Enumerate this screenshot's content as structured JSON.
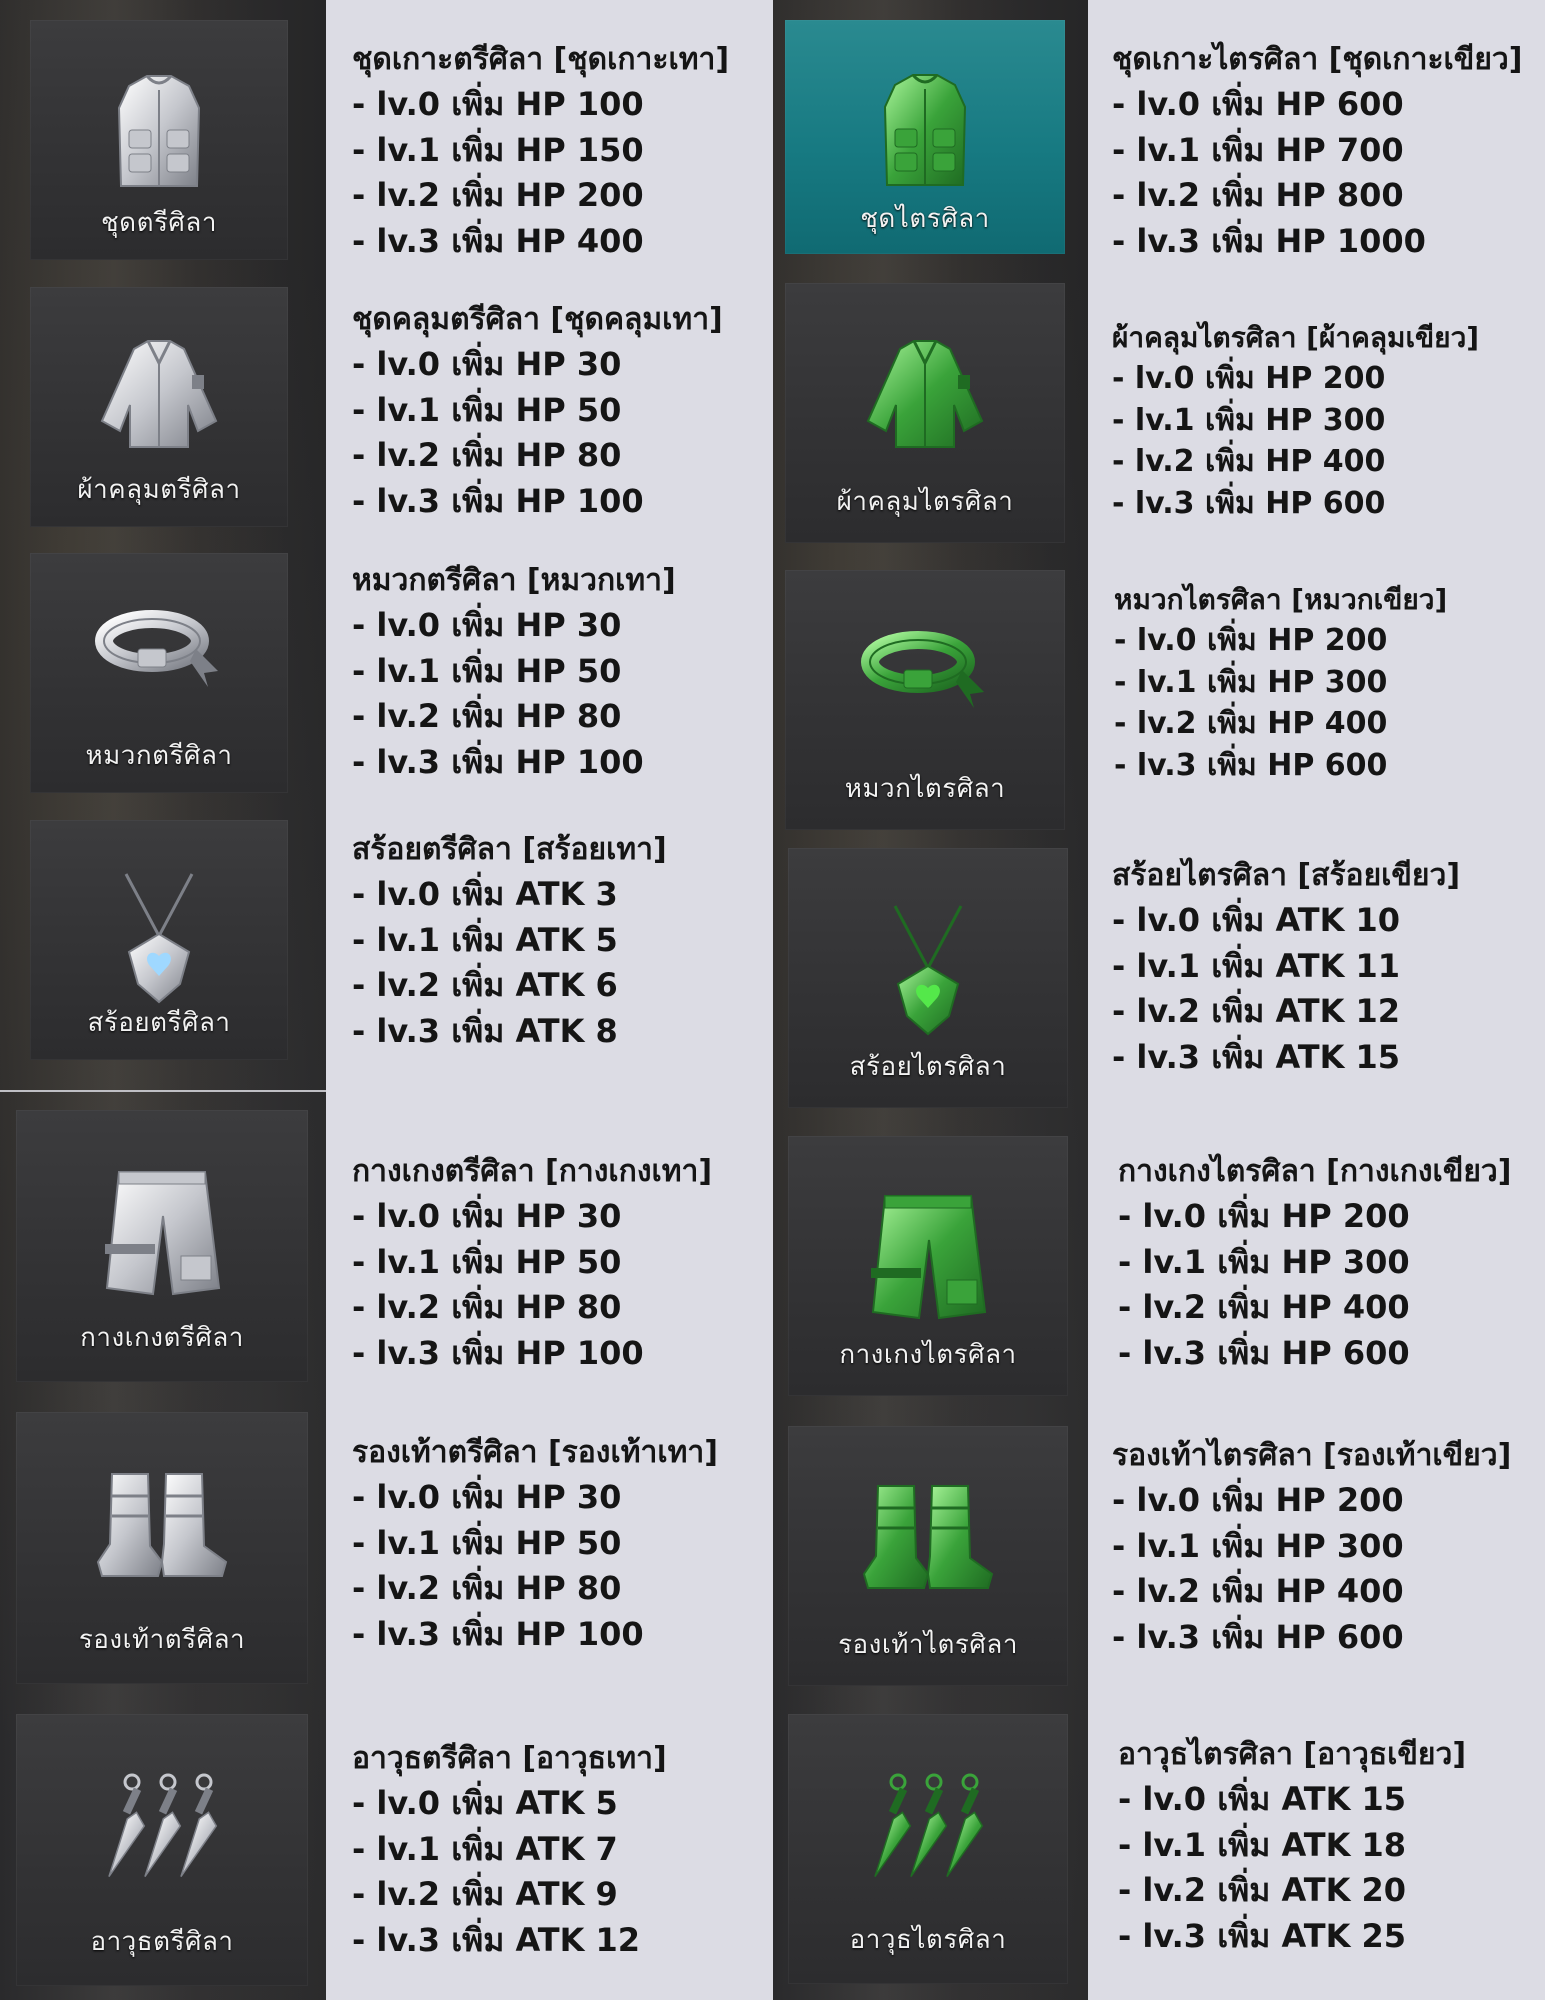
{
  "colors": {
    "page_bg": "#dcdce4",
    "tile_bg": "#333335",
    "tile_selected": "#177a82",
    "silver": "#c8c9ce",
    "green": "#3fa640",
    "text": "#151515"
  },
  "left_column": [
    {
      "icon": "vest-icon",
      "tile_label": "ชุดตรีศิลา",
      "title": "ชุดเกาะตรีศิลา [ชุดเกาะเทา]",
      "lines": [
        "- lv.0 เพิ่ม HP 100",
        "- lv.1 เพิ่ม HP 150",
        "- lv.2 เพิ่ม HP 200",
        "- lv.3 เพิ่ม HP 400"
      ]
    },
    {
      "icon": "jacket-icon",
      "tile_label": "ผ้าคลุมตรีศิลา",
      "title": "ชุดคลุมตรีศิลา [ชุดคลุมเทา]",
      "lines": [
        "- lv.0 เพิ่ม HP 30",
        "- lv.1 เพิ่ม HP 50",
        "- lv.2 เพิ่ม HP 80",
        "- lv.3 เพิ่ม HP 100"
      ]
    },
    {
      "icon": "headband-icon",
      "tile_label": "หมวกตรีศิลา",
      "title": "หมวกตรีศิลา [หมวกเทา]",
      "lines": [
        "- lv.0 เพิ่ม HP 30",
        "- lv.1 เพิ่ม HP 50",
        "- lv.2 เพิ่ม HP 80",
        "- lv.3 เพิ่ม HP 100"
      ]
    },
    {
      "icon": "necklace-icon",
      "tile_label": "สร้อยตรีศิลา",
      "title": "สร้อยตรีศิลา [สร้อยเทา]",
      "lines": [
        "- lv.0 เพิ่ม ATK 3",
        "- lv.1 เพิ่ม ATK 5",
        "- lv.2 เพิ่ม ATK 6",
        "- lv.3 เพิ่ม ATK 8"
      ]
    },
    {
      "icon": "pants-icon",
      "tile_label": "กางเกงตรีศิลา",
      "title": "กางเกงตรีศิลา [กางเกงเทา]",
      "lines": [
        "- lv.0 เพิ่ม HP 30",
        "- lv.1 เพิ่ม HP 50",
        "- lv.2 เพิ่ม HP 80",
        "- lv.3 เพิ่ม HP 100"
      ]
    },
    {
      "icon": "boots-icon",
      "tile_label": "รองเท้าตรีศิลา",
      "title": "รองเท้าตรีศิลา [รองเท้าเทา]",
      "lines": [
        "- lv.0 เพิ่ม HP 30",
        "- lv.1 เพิ่ม HP 50",
        "- lv.2 เพิ่ม HP 80",
        "- lv.3 เพิ่ม HP 100"
      ]
    },
    {
      "icon": "kunai-icon",
      "tile_label": "อาวุธตรีศิลา",
      "title": "อาวุธตรีศิลา [อาวุธเทา]",
      "lines": [
        "- lv.0 เพิ่ม ATK 5",
        "- lv.1 เพิ่ม ATK 7",
        "- lv.2 เพิ่ม ATK 9",
        "- lv.3 เพิ่ม ATK 12"
      ]
    }
  ],
  "right_column": [
    {
      "icon": "vest-icon",
      "tile_label": "ชุดไตรศิลา",
      "title": "ชุดเกาะไตรศิลา [ชุดเกาะเขียว]",
      "lines": [
        "- lv.0 เพิ่ม HP 600",
        "- lv.1 เพิ่ม HP 700",
        "- lv.2 เพิ่ม HP 800",
        "- lv.3 เพิ่ม HP 1000"
      ]
    },
    {
      "icon": "jacket-icon",
      "tile_label": "ผ้าคลุมไตรศิลา",
      "title": "ผ้าคลุมไตรศิลา [ผ้าคลุมเขียว]",
      "lines": [
        "- lv.0 เพิ่ม HP 200",
        "- lv.1 เพิ่ม HP 300",
        "- lv.2 เพิ่ม HP 400",
        "- lv.3 เพิ่ม HP 600"
      ]
    },
    {
      "icon": "headband-icon",
      "tile_label": "หมวกไตรศิลา",
      "title": "หมวกไตรศิลา [หมวกเขียว]",
      "lines": [
        "- lv.0 เพิ่ม HP 200",
        "- lv.1 เพิ่ม HP 300",
        "- lv.2 เพิ่ม HP 400",
        "- lv.3 เพิ่ม HP 600"
      ]
    },
    {
      "icon": "necklace-icon",
      "tile_label": "สร้อยไตรศิลา",
      "title": "สร้อยไตรศิลา [สร้อยเขียว]",
      "lines": [
        "- lv.0 เพิ่ม ATK 10",
        "- lv.1 เพิ่ม ATK 11",
        "- lv.2 เพิ่ม ATK 12",
        "- lv.3 เพิ่ม ATK 15"
      ]
    },
    {
      "icon": "pants-icon",
      "tile_label": "กางเกงไตรศิลา",
      "title": "กางเกงไตรศิลา [กางเกงเขียว]",
      "lines": [
        "- lv.0 เพิ่ม HP 200",
        "- lv.1 เพิ่ม HP 300",
        "- lv.2 เพิ่ม HP 400",
        "- lv.3 เพิ่ม HP 600"
      ]
    },
    {
      "icon": "boots-icon",
      "tile_label": "รองเท้าไตรศิลา",
      "title": "รองเท้าไตรศิลา [รองเท้าเขียว]",
      "lines": [
        "- lv.0 เพิ่ม HP 200",
        "- lv.1 เพิ่ม HP 300",
        "- lv.2 เพิ่ม HP 400",
        "- lv.3 เพิ่ม HP 600"
      ]
    },
    {
      "icon": "kunai-icon",
      "tile_label": "อาวุธไตรศิลา",
      "title": "อาวุธไตรศิลา [อาวุธเขียว]",
      "lines": [
        "- lv.0 เพิ่ม ATK 15",
        "- lv.1 เพิ่ม ATK 18",
        "- lv.2 เพิ่ม ATK 20",
        "- lv.3 เพิ่ม ATK 25"
      ]
    }
  ]
}
